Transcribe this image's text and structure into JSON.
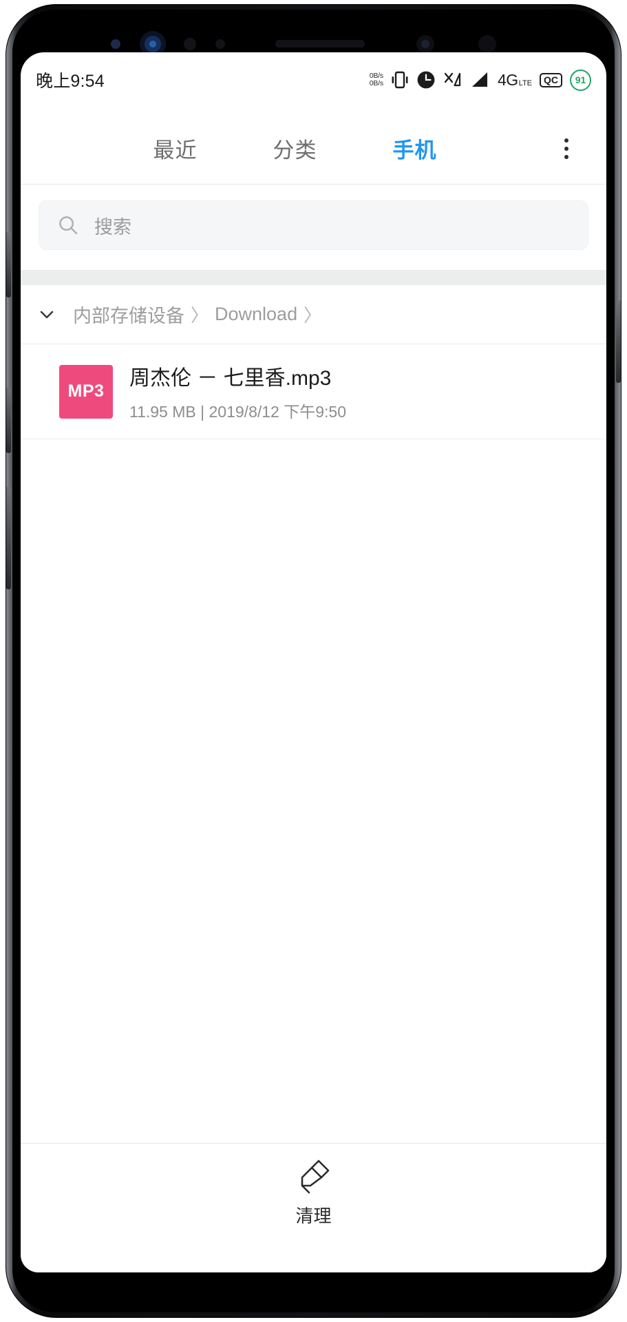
{
  "status_bar": {
    "time": "晚上9:54",
    "network_speed_up": "0B/s",
    "network_speed_down": "0B/s",
    "vibrate_icon": "vibrate-icon",
    "alarm_icon": "alarm-clock-icon",
    "mute_icon": "signal-cross-icon",
    "signal_icon": "signal-bars-icon",
    "network_type": "4G",
    "network_type_suffix": "LTE",
    "quick_charge_label": "QC",
    "battery_percent": "91"
  },
  "tabs": [
    {
      "label": "最近",
      "active": false
    },
    {
      "label": "分类",
      "active": false
    },
    {
      "label": "手机",
      "active": true
    }
  ],
  "overflow_menu": {
    "icon": "kebab-menu-icon"
  },
  "search": {
    "icon": "search-icon",
    "placeholder": "搜索",
    "value": ""
  },
  "breadcrumb": {
    "toggle_icon": "chevron-down-icon",
    "items": [
      "内部存储设备",
      "Download"
    ],
    "separator": "〉"
  },
  "files": [
    {
      "badge": "MP3",
      "badge_color": "#ef4a7e",
      "name": "周杰伦 － 七里香.mp3",
      "size": "11.95 MB",
      "separator": "|",
      "modified": "2019/8/12 下午9:50"
    }
  ],
  "bottom_bar": {
    "icon": "broom-clean-icon",
    "label": "清理"
  },
  "colors": {
    "accent": "#2196f3",
    "mp3_badge": "#ef4a7e",
    "battery_green": "#21a366",
    "muted_text": "#9d9d9d"
  }
}
